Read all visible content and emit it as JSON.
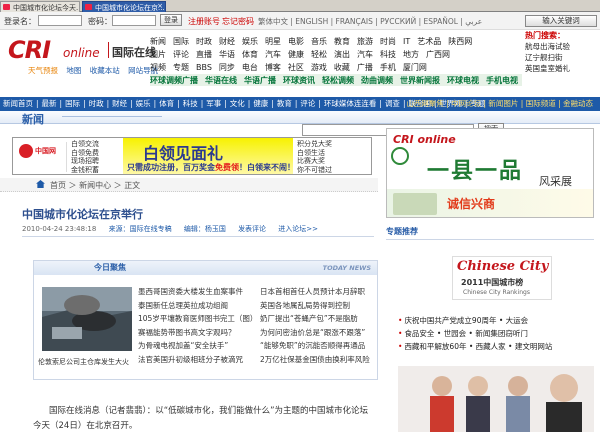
{
  "browser": {
    "tabs": [
      {
        "label": "中国城市化论坛今天..."
      },
      {
        "label": "中国城市化论坛在京..."
      }
    ]
  },
  "login": {
    "username_label": "登录名：",
    "password_label": "密码：",
    "login_button": "登录",
    "register": "注册账号",
    "forgot": "忘记密码",
    "languages": "繁体中文 | ENGLISH | FRANÇAIS | РУССКИЙ | ESPAÑOL | عربي"
  },
  "header": {
    "logo_cri": "CRI",
    "logo_online": "online",
    "logo_cn": "国际在线",
    "quicklinks": [
      "天气预报",
      "地图",
      "收藏本站",
      "网站导航"
    ],
    "nav_rows": [
      [
        "新闻",
        "国际",
        "时政",
        "财经",
        "娱乐",
        "明星",
        "电影",
        "音乐",
        "教育",
        "旅游",
        "时尚",
        "IT",
        "艺术品",
        "陕西网"
      ],
      [
        "图片",
        "评论",
        "直播",
        "华语",
        "体育",
        "汽车",
        "健康",
        "轻松",
        "演出",
        "汽车",
        "科技",
        "地方",
        "广西网"
      ],
      [
        "视频",
        "专题",
        "BBS",
        "同步",
        "电台",
        "博客",
        "社区",
        "游戏",
        "收藏",
        "广播",
        "手机",
        "厦门网"
      ]
    ],
    "special_row": [
      "环球调频广播",
      "华语在线",
      "华语广播",
      "环球资讯",
      "轻松调频",
      "劲曲调频",
      "世界新闻报",
      "环球电视",
      "手机电视"
    ],
    "search_button": "输入关键词",
    "hot_title": "热门搜索：",
    "hot_items": [
      "航母出海试验",
      "辽宁舰扫街",
      "英国皇室婚礼"
    ]
  },
  "mainnav": {
    "items": [
      "新闻首页",
      "最新",
      "国际",
      "时政",
      "财经",
      "娱乐",
      "体育",
      "科技",
      "军事",
      "文化",
      "健康",
      "教育",
      "评论",
      "环球媒体连连看",
      "调查",
      "联合国",
      "世界观",
      "专题"
    ],
    "right": "山西网聚焦 | 中网论坛 | 新闻图片 | 国际频道 | 金融动态"
  },
  "news": {
    "label": "新闻",
    "search_button": "搜索"
  },
  "ads": {
    "left_banner": {
      "brand": "中国网",
      "items_left": [
        "白领交流",
        "白领免费",
        "现场招聘",
        "金钱积蓄"
      ],
      "main": "白领见面礼",
      "sub": "只需成功注册，百万奖金",
      "highlight": "免费领",
      "end": "！白领来不闹！",
      "items_right": [
        "积分兑大奖",
        "白领生活",
        "比赛大奖",
        "你不可错过"
      ]
    },
    "right_banner": {
      "title": "一县一品",
      "subtitle": "风采展",
      "tagline": "诚信兴商",
      "brand": "CRI online"
    }
  },
  "breadcrumb": {
    "items": [
      "首页",
      "新闻中心",
      "正文"
    ]
  },
  "article": {
    "headline": "中国城市化论坛在京举行",
    "date": "2010-04-24 23:48:18",
    "source": "来源：国际在线专稿",
    "editor": "编辑：杨玉国",
    "comment": "发表评论",
    "forum": "进入论坛>>",
    "body": "国际在线消息（记者翡翡）：以“低碳城市化，我们能做什么”为主题的中国城市化论坛今天（24日）在北京召开。"
  },
  "today": {
    "title": "今日聚焦",
    "tag": "TODAY NEWS",
    "caption": "伦敦索尼公司主仓库发生大火",
    "col1": [
      "墨西哥国资委大楼发生血案事件",
      "泰国新任总理英拉成功组阁",
      "105岁平壤教育医师图书完工（图）",
      "赛福能势带图书高文字观吗？",
      "为骨魂电视加盖“安全扶手”",
      "法官美国升初级相班分子被滴咒"
    ],
    "col2": [
      "日本首相首任人员预计本月辞职",
      "英国各地属乱局势得到控制",
      "奶厂提出“苍蝇产包”不是脂肪",
      "为何问密油价总是“跟涨不跟落”",
      "“能够免职”的沉能否顺得再通品",
      "2万亿社保基金国债由换利率风险"
    ]
  },
  "sidebar": {
    "zhuanti": "专题推荐",
    "banner_title": "Chinese City",
    "banner_sub": "2011中国城市榜",
    "banner_en": "Chinese City Rankings",
    "list": [
      "庆祝中国共产党成立90周年 • 大运会",
      "食品安全 • 世园会 • 新闻集团窃听门",
      "西藏和平解放60年 • 西藏人家 • 建文明网站"
    ]
  }
}
